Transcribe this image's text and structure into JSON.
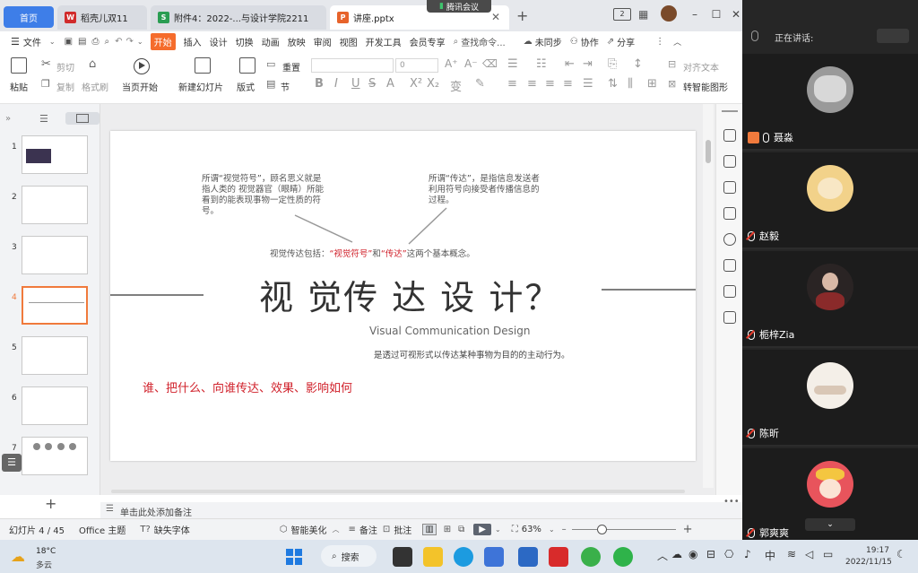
{
  "tabs": {
    "home": "首页",
    "doc1": "稻壳儿双11",
    "doc2": "附件4：2022-...与设计学院2211",
    "doc3": "讲座.pptx"
  },
  "meeting": {
    "badge": "腾讯会议",
    "speaking_label": "正在讲话:"
  },
  "menu": {
    "file": "文件",
    "items": [
      "开始",
      "插入",
      "设计",
      "切换",
      "动画",
      "放映",
      "审阅",
      "视图",
      "开发工具",
      "会员专享"
    ],
    "search": "查找命令...",
    "unsync": "未同步",
    "collab": "协作",
    "share": "分享"
  },
  "ribbon": {
    "paste": "粘贴",
    "cut": "剪切",
    "copy": "复制",
    "format_brush": "格式刷",
    "from_current": "当页开始",
    "new_slide": "新建幻灯片",
    "layout": "版式",
    "section": "节",
    "reset": "重置",
    "font_size": "0",
    "align_text": "对齐文本",
    "convert_shape": "转智能图形"
  },
  "thumbnails": [
    "1",
    "2",
    "3",
    "4",
    "5",
    "6",
    "7"
  ],
  "slide": {
    "note_left": "所谓“视觉符号”，顾名思义就是指人类的 视觉器官（眼睛）所能看到的能表现事物一定性质的符号。",
    "note_right": "所谓“传达”，是指信息发送者利用符号向接受者传播信息的过程。",
    "includes_prefix": "视觉传达包括：",
    "includes_sym": "“视觉符号”",
    "includes_and": "和",
    "includes_conv": "“传达”",
    "includes_suffix": "这两个基本概念。",
    "title": "视 觉传 达 设 计？",
    "subtitle": "Visual Communication Design",
    "definition": "是透过可视形式以传达某种事物为目的的主动行为。",
    "question": "谁、把什么、向谁传达、效果、影响如何"
  },
  "notes": {
    "placeholder": "单击此处添加备注"
  },
  "status": {
    "slide_index": "幻灯片 4 / 45",
    "theme": "Office 主题",
    "missing_font": "缺失字体",
    "beautify": "智能美化",
    "notes": "备注",
    "comment": "批注",
    "zoom": "63%"
  },
  "participants": [
    {
      "name": "聂淼"
    },
    {
      "name": "赵毅"
    },
    {
      "name": "栀梓Zia"
    },
    {
      "name": "陈昕"
    },
    {
      "name": "郭爽爽"
    }
  ],
  "taskbar": {
    "temp": "18°C",
    "weather": "多云",
    "search": "搜索",
    "ime": "中",
    "time": "19:17",
    "date": "2022/11/15"
  },
  "colors": {
    "accent": "#f56c2c",
    "red_text": "#d0202a",
    "home_tab": "#3e7ee8"
  }
}
